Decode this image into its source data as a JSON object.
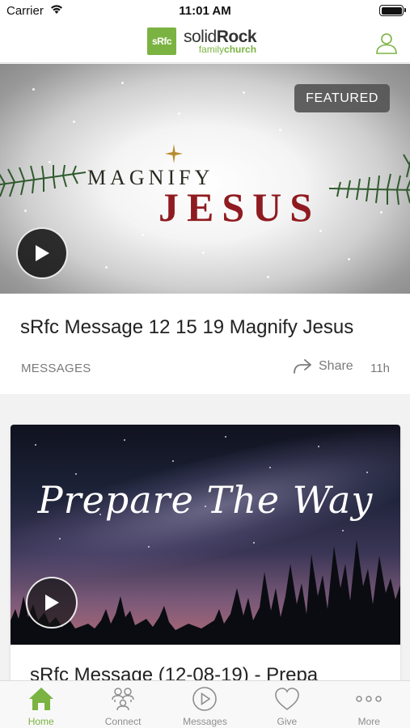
{
  "status_bar": {
    "carrier": "Carrier",
    "time": "11:01 AM"
  },
  "header": {
    "logo_badge": "sRfc",
    "logo_main_light": "solid",
    "logo_main_bold": "Rock",
    "logo_sub_light": "family",
    "logo_sub_bold": "church",
    "profile_icon": "user-icon"
  },
  "featured": {
    "badge": "FEATURED",
    "artwork_line1": "MAGNIFY",
    "artwork_line2": "JESUS",
    "title": "sRfc Message 12 15 19 Magnify Jesus",
    "category": "MESSAGES",
    "share_label": "Share",
    "age": "11h"
  },
  "card2": {
    "artwork_text": "Prepare The Way",
    "title": "sRfc Message (12-08-19) - Prepa"
  },
  "tabs": [
    {
      "label": "Home",
      "icon": "home-icon",
      "active": true
    },
    {
      "label": "Connect",
      "icon": "connect-icon",
      "active": false
    },
    {
      "label": "Messages",
      "icon": "play-circle-icon",
      "active": false
    },
    {
      "label": "Give",
      "icon": "heart-icon",
      "active": false
    },
    {
      "label": "More",
      "icon": "more-dots-icon",
      "active": false
    }
  ],
  "colors": {
    "brand_green": "#7bb342",
    "inactive_gray": "#8e8e8e",
    "jesus_red": "#8f1b20"
  }
}
